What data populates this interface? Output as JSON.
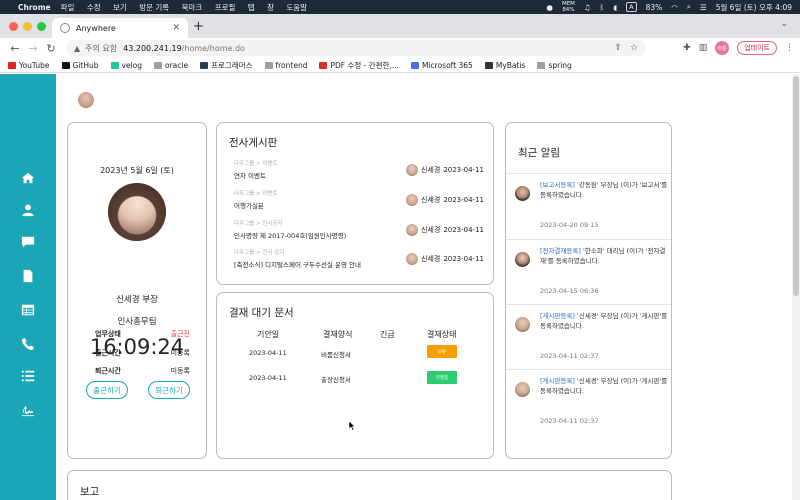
{
  "menubar": {
    "app": "Chrome",
    "menus": [
      "파일",
      "수정",
      "보기",
      "방문 기록",
      "북마크",
      "프로필",
      "탭",
      "창",
      "도움말"
    ],
    "mem_label": "MEM",
    "mem_value": "84%",
    "battery": "83%",
    "input_key": "A",
    "datetime": "5월 6일 (토) 오후 4:09"
  },
  "browser": {
    "tab_title": "Anywhere",
    "security_label": "주의 요함",
    "url_host": "43.200.241.19",
    "url_path": "/home/home.do",
    "profile_label": "마툰",
    "update_label": "업데이트"
  },
  "bookmarks": [
    {
      "label": "YouTube",
      "color": "#e62117"
    },
    {
      "label": "GitHub",
      "color": "#111111"
    },
    {
      "label": "velog",
      "color": "#20c997"
    },
    {
      "label": "oracle",
      "color": "#9aa0a6"
    },
    {
      "label": "프로그래머스",
      "color": "#2b3b55"
    },
    {
      "label": "frontend",
      "color": "#9aa0a6"
    },
    {
      "label": "PDF 수정 - 간편한,...",
      "color": "#d93025"
    },
    {
      "label": "Microsoft 365",
      "color": "#4f6bed"
    },
    {
      "label": "MyBatis",
      "color": "#333333"
    },
    {
      "label": "spring",
      "color": "#9aa0a6"
    }
  ],
  "sidebar": {
    "color": "#1aa6b7",
    "items": [
      "home-icon",
      "user-icon",
      "chat-icon",
      "document-icon",
      "table-icon",
      "phone-icon",
      "list-icon",
      "signature-icon"
    ]
  },
  "profile": {
    "date": "2023년 5월 6일 (토)",
    "name": "신세경 부장",
    "department": "인사총무팀",
    "clock": "16:09:24",
    "status_rows": [
      {
        "key": "업무상태",
        "value": "출근전"
      },
      {
        "key": "출근시간",
        "value": "미등록"
      },
      {
        "key": "퇴근시간",
        "value": "미등록"
      }
    ],
    "checkin_label": "출근하기",
    "checkout_label": "퇴근하기"
  },
  "board": {
    "title": "전사게시판",
    "posts": [
      {
        "category": "다우그룹 > 이벤트",
        "title": "연차 이벤트",
        "author": "신세경",
        "date": "2023-04-11"
      },
      {
        "category": "다우그룹 > 이벤트",
        "title": "어행가실분",
        "author": "신세경",
        "date": "2023-04-11"
      },
      {
        "category": "다우그룹 > 인사공지",
        "title": "인사명령 제 2017-004호(임원인사명령)",
        "author": "신세경",
        "date": "2023-04-11"
      },
      {
        "category": "다우그룹 > 전사 공지",
        "title": "[축전소식] 디지털스페어 구두수선실 운영 안내",
        "author": "신세경",
        "date": "2023-04-11"
      }
    ]
  },
  "approval": {
    "title": "결재 대기 문서",
    "headers": [
      "기안일",
      "결재양식",
      "긴급",
      "결재상태"
    ],
    "rows": [
      {
        "date": "2023-04-11",
        "form": "비품신청서",
        "urgent": "",
        "status": "보류",
        "status_color": "#f5a000"
      },
      {
        "date": "2023-04-11",
        "form": "출장신청서",
        "urgent": "",
        "status": "진행중",
        "status_color": "#2ecc71"
      }
    ]
  },
  "notifications": {
    "title": "최근 알림",
    "items": [
      {
        "tag": "[보고서등록]",
        "text": " '강동원' 부장님 (이)가 '보고서'를 등록하였습니다.",
        "time": "2023-04-20 09:15"
      },
      {
        "tag": "[전자결재등록]",
        "text": " '한소희' 대리님 (이)가 '전자결재'를 등록하였습니다.",
        "time": "2023-04-15 06:36"
      },
      {
        "tag": "[게시판등록]",
        "text": " '신세경' 부장님 (이)가 '게시판'를 등록하였습니다.",
        "time": "2023-04-11 02:37"
      },
      {
        "tag": "[게시판등록]",
        "text": " '신세경' 부장님 (이)가 '게시판'를 등록하였습니다.",
        "time": "2023-04-11 02:37"
      }
    ]
  },
  "report": {
    "title": "보고"
  }
}
